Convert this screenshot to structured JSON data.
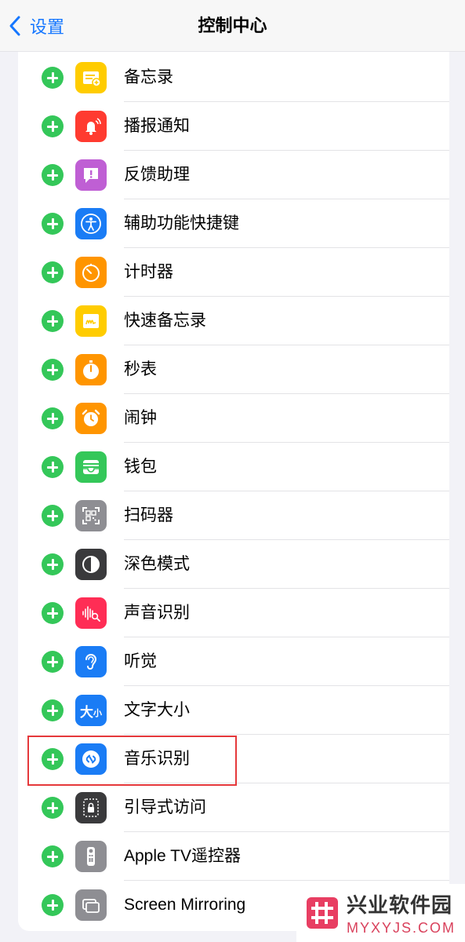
{
  "nav": {
    "back_label": "设置",
    "title": "控制中心"
  },
  "items": [
    {
      "label": "备忘录",
      "icon": "notes-icon",
      "bg": "#ffcc00"
    },
    {
      "label": "播报通知",
      "icon": "announce-bell-icon",
      "bg": "#ff3b30"
    },
    {
      "label": "反馈助理",
      "icon": "feedback-icon",
      "bg": "#bf5fd4"
    },
    {
      "label": "辅助功能快捷键",
      "icon": "accessibility-icon",
      "bg": "#1a7cf5"
    },
    {
      "label": "计时器",
      "icon": "timer-icon",
      "bg": "#ff9500"
    },
    {
      "label": "快速备忘录",
      "icon": "quick-note-icon",
      "bg": "#ffcc00"
    },
    {
      "label": "秒表",
      "icon": "stopwatch-icon",
      "bg": "#ff9500"
    },
    {
      "label": "闹钟",
      "icon": "alarm-icon",
      "bg": "#ff9500"
    },
    {
      "label": "钱包",
      "icon": "wallet-icon",
      "bg": "#34c759"
    },
    {
      "label": "扫码器",
      "icon": "qr-scanner-icon",
      "bg": "#8e8e93"
    },
    {
      "label": "深色模式",
      "icon": "dark-mode-icon",
      "bg": "#3a3a3c"
    },
    {
      "label": "声音识别",
      "icon": "sound-recognition-icon",
      "bg": "#ff2d55"
    },
    {
      "label": "听觉",
      "icon": "hearing-icon",
      "bg": "#1a7cf5"
    },
    {
      "label": "文字大小",
      "icon": "text-size-icon",
      "bg": "#1a7cf5",
      "icon_text_big": "大",
      "icon_text_small": "小"
    },
    {
      "label": "音乐识别",
      "icon": "shazam-icon",
      "bg": "#1a7cf5"
    },
    {
      "label": "引导式访问",
      "icon": "guided-access-icon",
      "bg": "#3a3a3c"
    },
    {
      "label": "Apple TV遥控器",
      "icon": "tv-remote-icon",
      "bg": "#8e8e93"
    },
    {
      "label": "Screen Mirroring",
      "icon": "screen-mirroring-icon",
      "bg": "#8e8e93"
    }
  ],
  "watermark": {
    "cn": "兴业软件园",
    "en": "MYXYJS.COM"
  }
}
